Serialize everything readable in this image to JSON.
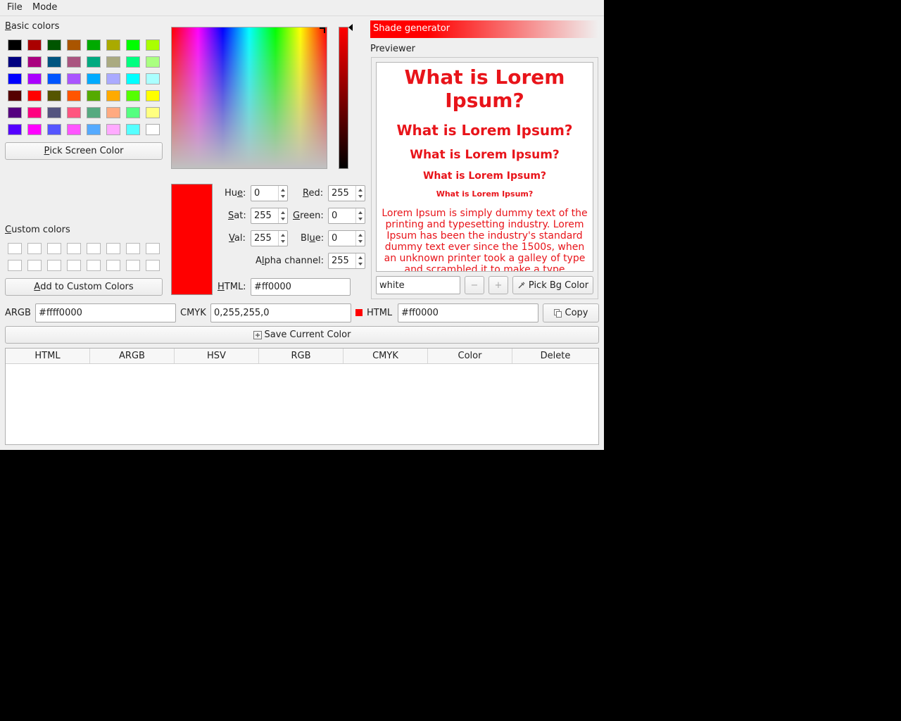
{
  "menu": {
    "file": "File",
    "mode": "Mode"
  },
  "basic_colors": {
    "label_first": "B",
    "label_rest": "asic colors",
    "swatches": [
      "#000000",
      "#aa0000",
      "#005500",
      "#aa5500",
      "#00aa00",
      "#aaaa00",
      "#00ff00",
      "#aaff00",
      "#000080",
      "#aa007f",
      "#005580",
      "#aa5580",
      "#00aa80",
      "#aaaa80",
      "#00ff80",
      "#aaff80",
      "#0000ff",
      "#aa00ff",
      "#0055ff",
      "#aa55ff",
      "#00aaff",
      "#aaaaff",
      "#00ffff",
      "#aaffff",
      "#550000",
      "#ff0000",
      "#555500",
      "#ff5500",
      "#55aa00",
      "#ffaa00",
      "#55ff00",
      "#ffff00",
      "#550080",
      "#ff0080",
      "#555580",
      "#ff5580",
      "#55aa80",
      "#ffaa80",
      "#55ff80",
      "#ffff80",
      "#5500ff",
      "#ff00ff",
      "#5555ff",
      "#ff55ff",
      "#55aaff",
      "#ffaaff",
      "#55ffff",
      "#ffffff"
    ]
  },
  "pick_screen": {
    "first": "P",
    "rest": "ick Screen Color"
  },
  "custom_colors": {
    "first": "C",
    "rest": "ustom colors"
  },
  "add_custom": {
    "first": "A",
    "rest": "dd to Custom Colors"
  },
  "current_color": "#ff0000",
  "hsv": {
    "hue_label_a": "Hu",
    "hue_label_u": "e",
    "hue_label_b": ":",
    "hue": "0",
    "sat_label_u": "S",
    "sat_label_b": "at:",
    "sat": "255",
    "val_label_u": "V",
    "val_label_b": "al:",
    "val": "255"
  },
  "rgb": {
    "red_label_u": "R",
    "red_label_b": "ed:",
    "red": "255",
    "green_label_u": "G",
    "green_label_b": "reen:",
    "green": "0",
    "blue_label_a": "Bl",
    "blue_label_u": "u",
    "blue_label_b": "e:",
    "blue": "0"
  },
  "alpha": {
    "label_a": "A",
    "label_u": "l",
    "label_b": "pha channel:",
    "value": "255"
  },
  "html_field": {
    "label_u": "H",
    "label_b": "TML:",
    "value": "#ff0000"
  },
  "shade_generator": {
    "title": "Shade generator",
    "color": "#ff0000"
  },
  "previewer": {
    "title": "Previewer",
    "h1": "What is Lorem Ipsum?",
    "h2": "What is Lorem Ipsum?",
    "h3": "What is Lorem Ipsum?",
    "h4": "What is Lorem Ipsum?",
    "h5": "What is Lorem Ipsum?",
    "body": "Lorem Ipsum is simply dummy text of the printing and typesetting industry. Lorem Ipsum has been the industry's standard dummy text ever since the 1500s, when an unknown printer took a galley of type and scrambled it to make a type specimen book.",
    "bg_value": "white",
    "minus": "−",
    "plus": "+",
    "pick_bg": "Pick Bg Color"
  },
  "formats": {
    "argb_label": "ARGB",
    "argb": "#ffff0000",
    "cmyk_label": "CMYK",
    "cmyk": "0,255,255,0",
    "html_label": "HTML",
    "html": "#ff0000",
    "copy": "Copy"
  },
  "save_current": "Save Current Color",
  "table": {
    "columns": [
      "HTML",
      "ARGB",
      "HSV",
      "RGB",
      "CMYK",
      "Color",
      "Delete"
    ],
    "rows": []
  }
}
